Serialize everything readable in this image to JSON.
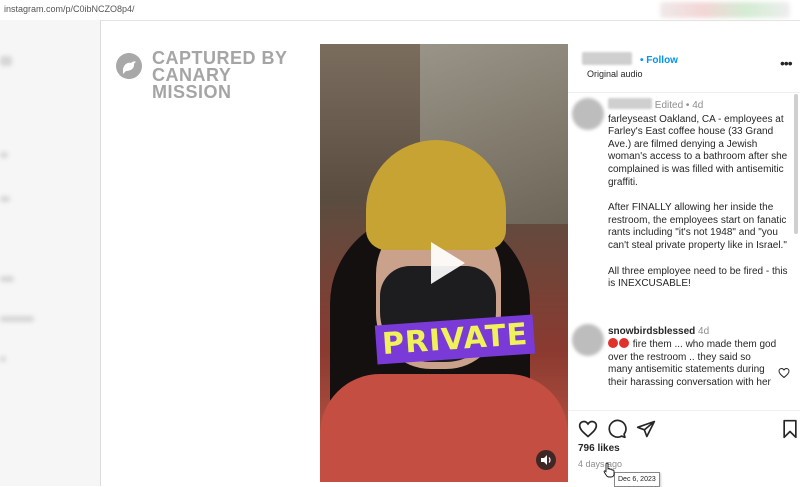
{
  "browser": {
    "url": "instagram.com/p/C0ibNCZO8p4/"
  },
  "watermark": {
    "line1": "CAPTURED BY",
    "line2": "CANARY MISSION"
  },
  "video": {
    "sticker_text": "PRIVATE"
  },
  "post": {
    "header": {
      "follow_label": "Follow",
      "audio_label": "Original audio",
      "separator": "•"
    },
    "caption": {
      "status": "Edited",
      "separator": "•",
      "age": "4d",
      "author": "farleyseast",
      "paragraphs": [
        "farleyseast Oakland, CA - employees at Farley's East coffee house (33 Grand Ave.) are filmed denying a Jewish woman's access to a bathroom after she complained is was filled with antisemitic graffiti.",
        "After FINALLY allowing her inside the restroom, the employees start on fanatic rants including \"it's not 1948\" and \"you can't steal private property like in Israel.\"",
        "All three employee need to be fired - this is INEXCUSABLE!"
      ]
    },
    "comment": {
      "username": "snowbirdsblessed",
      "age": "4d",
      "text": "fire them ... who made them god over the restroom .. they said so many antisemitic statements during their harassing conversation with her"
    },
    "likes": "796 likes",
    "time_ago": "4 days ago",
    "tooltip": "Dec 6, 2023"
  },
  "icons": {
    "like": "heart-icon",
    "comment": "comment-icon",
    "share": "share-icon",
    "save": "bookmark-icon",
    "play": "play-icon",
    "sound": "speaker-icon",
    "more": "more-options-icon"
  },
  "colors": {
    "link_blue": "#0095f6",
    "text": "#262626",
    "muted": "#8e8e8e",
    "sticker_purple": "#7a3ad8",
    "sticker_text": "#f0f25a"
  }
}
